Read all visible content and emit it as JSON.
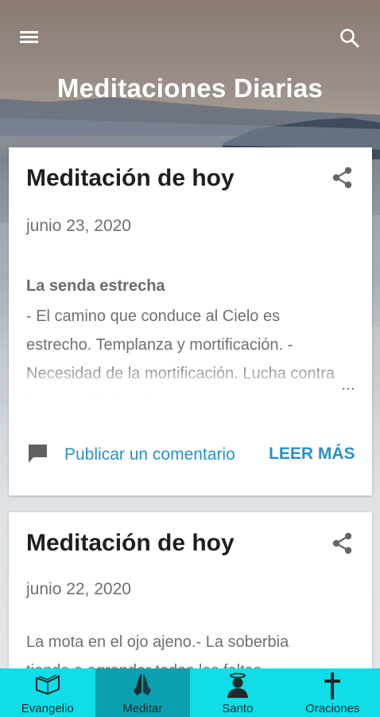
{
  "app": {
    "title": "Meditaciones Diarias"
  },
  "header": {
    "menu_icon": "menu-icon",
    "search_icon": "search-icon"
  },
  "posts": [
    {
      "title": "Meditación de hoy",
      "date": "junio 23, 2020",
      "excerpt_heading": "La senda estrecha",
      "excerpt": "- El camino que conduce al Cielo es estrecho. Templanza y mortificación. - Necesidad de la mortificación. Lucha contra la comodidad y el",
      "ellipsis": "…",
      "comment_label": "Publicar un comentario",
      "read_more_label": "LEER MÁS"
    },
    {
      "title": "Meditación de hoy",
      "date": "junio 22, 2020",
      "excerpt": "La mota en el ojo ajeno.- La soberbia tiende a agrandar todas las faltas"
    }
  ],
  "bottom_nav": [
    {
      "label": "Evangelio",
      "icon": "book-icon",
      "active": false
    },
    {
      "label": "Meditar",
      "icon": "praying-hands-icon",
      "active": true
    },
    {
      "label": "Santo",
      "icon": "saint-icon",
      "active": false
    },
    {
      "label": "Oraciones",
      "icon": "cross-icon",
      "active": false
    }
  ],
  "colors": {
    "accent": "#2a90c8",
    "nav_bg": "#0fdde8",
    "nav_active": "#0aa0b0"
  }
}
